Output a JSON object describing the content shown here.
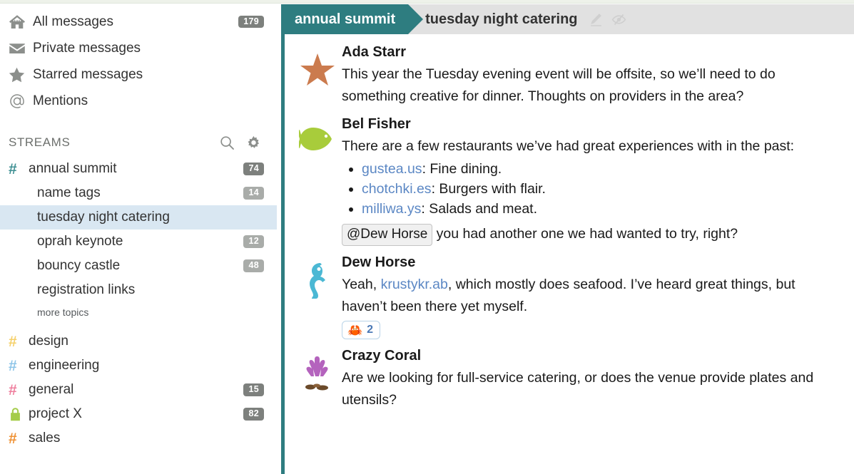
{
  "sidebar": {
    "nav": [
      {
        "label": "All messages",
        "icon": "home-icon",
        "badge": "179"
      },
      {
        "label": "Private messages",
        "icon": "envelope-icon",
        "badge": ""
      },
      {
        "label": "Starred messages",
        "icon": "star-icon",
        "badge": ""
      },
      {
        "label": "Mentions",
        "icon": "at-sign-icon",
        "badge": ""
      }
    ],
    "streams_header": {
      "title": "STREAMS",
      "search_icon": "search-icon",
      "gear_icon": "gear-icon"
    },
    "streams": [
      {
        "name": "annual summit",
        "hash_color": "#3f9093",
        "badge": "74",
        "private": false,
        "topics": [
          {
            "name": "name tags",
            "badge": "14",
            "selected": false
          },
          {
            "name": "tuesday night catering",
            "badge": "",
            "selected": true
          },
          {
            "name": "oprah keynote",
            "badge": "12",
            "selected": false
          },
          {
            "name": "bouncy castle",
            "badge": "48",
            "selected": false
          },
          {
            "name": "registration links",
            "badge": "",
            "selected": false
          }
        ],
        "more_topics": "more topics"
      },
      {
        "name": "design",
        "hash_color": "#f5d06a",
        "badge": "",
        "private": false,
        "topics": []
      },
      {
        "name": "engineering",
        "hash_color": "#8ec5e8",
        "badge": "",
        "private": false,
        "topics": []
      },
      {
        "name": "general",
        "hash_color": "#ef7f9e",
        "badge": "15",
        "private": false,
        "topics": []
      },
      {
        "name": "project X",
        "hash_color": "#a5cc4a",
        "badge": "82",
        "private": true,
        "topics": []
      },
      {
        "name": "sales",
        "hash_color": "#ef9133",
        "badge": "",
        "private": false,
        "topics": []
      }
    ]
  },
  "main": {
    "topic_bar": {
      "stream": "annual summit",
      "topic": "tuesday night catering",
      "edit_icon": "pencil-icon",
      "mute_icon": "eye-slash-icon",
      "stream_color": "#2e7d80"
    },
    "messages": [
      {
        "sender": "Ada Starr",
        "avatar": "starfish-icon",
        "text": "This year the Tuesday evening event will be offsite, so we’ll need to do something creative for dinner. Thoughts on providers in the area?"
      },
      {
        "sender": "Bel Fisher",
        "avatar": "fish-icon",
        "text": "There are a few restaurants we’ve had great experiences with in the past:",
        "links": [
          {
            "url": "gustea.us",
            "desc": ": Fine dining."
          },
          {
            "url": "chotchki.es",
            "desc": ": Burgers with flair."
          },
          {
            "url": "milliwa.ys",
            "desc": ": Salads and meat."
          }
        ],
        "mention": "@Dew Horse",
        "after_mention": " you had another one we had wanted to try, right?"
      },
      {
        "sender": "Dew Horse",
        "avatar": "seahorse-icon",
        "text_before": "Yeah, ",
        "link": "krustykr.ab",
        "text_after": ", which mostly does seafood. I’ve heard great things, but haven’t been there yet myself.",
        "reaction": {
          "emoji": "🦀",
          "count": "2"
        }
      },
      {
        "sender": "Crazy Coral",
        "avatar": "coral-icon",
        "text": "Are we looking for full-service catering, or does the venue provide plates and utensils?"
      }
    ]
  }
}
